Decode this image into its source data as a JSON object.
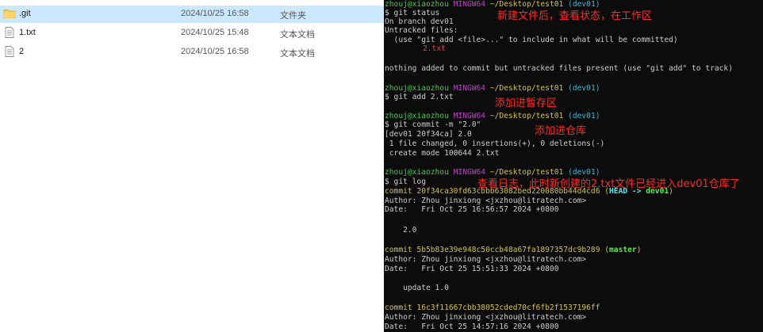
{
  "explorer": {
    "files": [
      {
        "name": ".git",
        "modified": "2024/10/25 16:58",
        "type": "文件夹",
        "icon": "folder-icon"
      },
      {
        "name": "1.txt",
        "modified": "2024/10/25 15:48",
        "type": "文本文档",
        "icon": "text-file-icon"
      },
      {
        "name": "2",
        "modified": "2024/10/25 16:58",
        "type": "文本文档",
        "icon": "text-file-icon"
      }
    ]
  },
  "terminal": {
    "prompt": {
      "user": "zhouj@xiaozhou",
      "shell": "MINGW64",
      "path": "~/Desktop/test01",
      "branch": "(dev01)"
    },
    "commands": {
      "status": "$ git status",
      "add": "$ git add 2.txt",
      "commit": "$ git commit -m \"2.0\"",
      "log": "$ git log"
    },
    "status_output": {
      "branch_line": "On branch dev01",
      "untracked_header": "Untracked files:",
      "hint": "  (use \"git add <file>...\" to include in what will be committed)",
      "file": "2.txt",
      "summary": "nothing added to commit but untracked files present (use \"git add\" to track)"
    },
    "commit_output": {
      "head": "[dev01 20f34ca] 2.0",
      "stats": " 1 file changed, 0 insertions(+), 0 deletions(-)",
      "mode": " create mode 100644 2.txt"
    },
    "log": [
      {
        "commit_line": "commit 20f34ca30fd63cbbb63082bed220080bb44d4cd6",
        "refs_open": " (",
        "head_ref": "HEAD -> ",
        "branch_ref": "dev01",
        "refs_close": ")",
        "author": "Author: Zhou jinxiong <jxzhou@litratech.com>",
        "date": "Date:   Fri Oct 25 16:56:57 2024 +0800",
        "message": "    2.0"
      },
      {
        "commit_line": "commit 5b5b83e39e948c50ccb48a67fa1897357dc9b289",
        "refs_open": " (",
        "branch_ref": "master",
        "refs_close": ")",
        "author": "Author: Zhou jinxiong <jxzhou@litratech.com>",
        "date": "Date:   Fri Oct 25 15:51:33 2024 +0800",
        "message": "    update 1.0"
      },
      {
        "commit_line": "commit 16c3f11667cbb38052cded70cf6fb2f1537196ff",
        "author": "Author: Zhou jinxiong <jxzhou@litratech.com>",
        "date": "Date:   Fri Oct 25 14:57:16 2024 +0800"
      }
    ],
    "annotations": {
      "status": "新建文件后，查看状态，在工作区",
      "add": "添加进暂存区",
      "commit": "添加进仓库",
      "log": "查看日志，此时新创建的2.txt文件已经进入dev01仓库了"
    }
  },
  "colors": {
    "selected_row": "#cce8ff",
    "terminal_bg": "#0c0c0c",
    "prompt_user": "#4ec94e",
    "prompt_shell": "#c040c8",
    "prompt_path": "#d4c24a",
    "prompt_branch": "#3fb8d4",
    "untracked_file": "#e04848",
    "annotation": "#ff2b2b"
  }
}
